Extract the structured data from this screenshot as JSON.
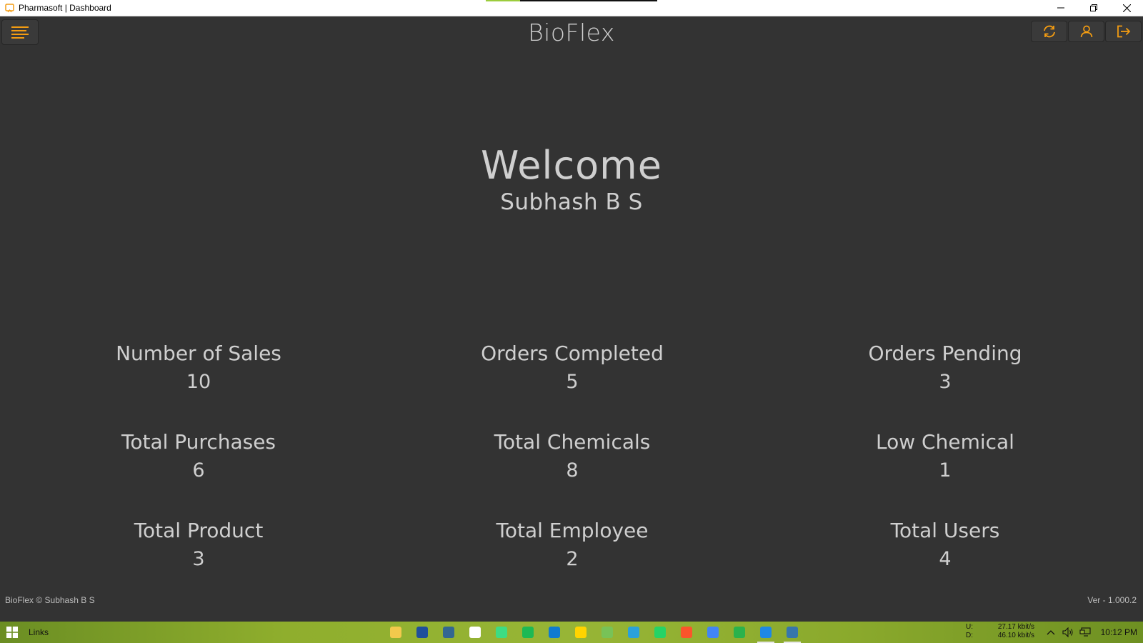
{
  "window": {
    "title": "Pharmasoft | Dashboard",
    "controls": [
      "minimize",
      "restore",
      "close"
    ]
  },
  "header": {
    "app_name": "BioFlex",
    "menu_icon": "hamburger-menu-icon",
    "actions": [
      {
        "name": "refresh-icon"
      },
      {
        "name": "user-icon"
      },
      {
        "name": "logout-icon"
      }
    ],
    "accent_color": "#f39c12"
  },
  "welcome": {
    "greeting": "Welcome",
    "user_name": "Subhash B S"
  },
  "stats": [
    {
      "label": "Number of Sales",
      "value": "10"
    },
    {
      "label": "Orders Completed",
      "value": "5"
    },
    {
      "label": "Orders Pending",
      "value": "3"
    },
    {
      "label": "Total Purchases",
      "value": "6"
    },
    {
      "label": "Total Chemicals",
      "value": "8"
    },
    {
      "label": "Low Chemical",
      "value": "1"
    },
    {
      "label": "Total Product",
      "value": "3"
    },
    {
      "label": "Total Employee",
      "value": "2"
    },
    {
      "label": "Total Users",
      "value": "4"
    }
  ],
  "footer": {
    "copyright": "BioFlex © Subhash B S",
    "version": "Ver - 1.000.2"
  },
  "taskbar": {
    "links_label": "Links",
    "apps": [
      {
        "name": "file-explorer-icon",
        "color": "#f2c94c"
      },
      {
        "name": "virtualbox-icon",
        "color": "#1f4f9c"
      },
      {
        "name": "postgres-icon",
        "color": "#336791"
      },
      {
        "name": "store-icon",
        "color": "#ffffff"
      },
      {
        "name": "android-studio-icon",
        "color": "#3ddc84"
      },
      {
        "name": "spotify-icon",
        "color": "#1db954"
      },
      {
        "name": "edge-icon",
        "color": "#0f7bcf"
      },
      {
        "name": "sticky-notes-icon",
        "color": "#ffd400"
      },
      {
        "name": "android-icon",
        "color": "#78c257"
      },
      {
        "name": "telegram-icon",
        "color": "#2aa1da"
      },
      {
        "name": "whatsapp-icon",
        "color": "#25d366"
      },
      {
        "name": "brave-icon",
        "color": "#fb542b"
      },
      {
        "name": "chrome-icon",
        "color": "#4285f4"
      },
      {
        "name": "dbeaver-icon",
        "color": "#2bb24c"
      },
      {
        "name": "vscode-icon",
        "color": "#1e88e5"
      },
      {
        "name": "python-app-icon",
        "color": "#3776ab"
      }
    ],
    "net_up_label": "U:",
    "net_up": "27.17 kbit/s",
    "net_down_label": "D:",
    "net_down": "46.10 kbit/s",
    "clock": "10:12 PM"
  }
}
